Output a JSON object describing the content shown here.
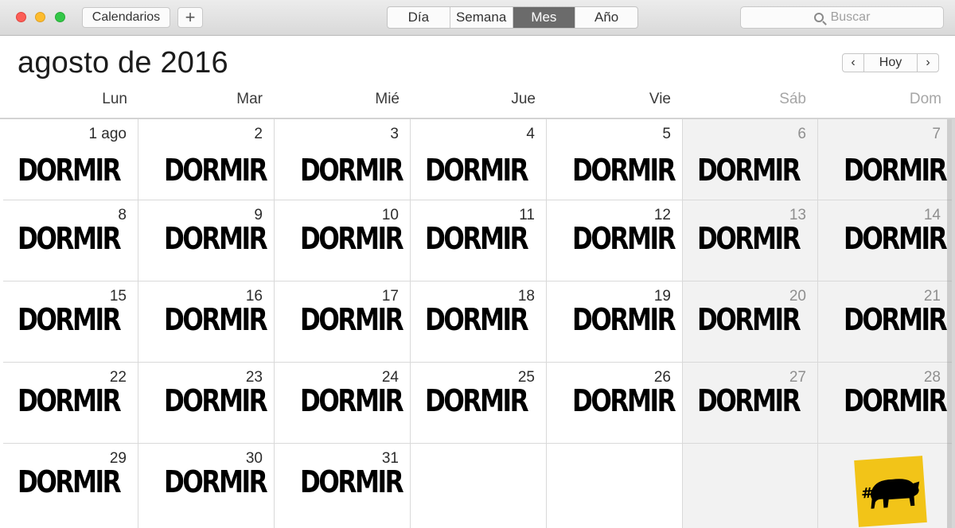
{
  "toolbar": {
    "calendars_label": "Calendarios",
    "add_label": "+",
    "view_modes": [
      "Día",
      "Semana",
      "Mes",
      "Año"
    ],
    "active_mode": "Mes",
    "search_placeholder": "Buscar"
  },
  "header": {
    "month_title": "agosto de 2016",
    "prev_label": "‹",
    "today_label": "Hoy",
    "next_label": "›"
  },
  "weekdays": [
    "Lun",
    "Mar",
    "Mié",
    "Jue",
    "Vie",
    "Sáb",
    "Dom"
  ],
  "weeks": [
    [
      "1 ago",
      "2",
      "3",
      "4",
      "5",
      "6",
      "7"
    ],
    [
      "8",
      "9",
      "10",
      "11",
      "12",
      "13",
      "14"
    ],
    [
      "15",
      "16",
      "17",
      "18",
      "19",
      "20",
      "21"
    ],
    [
      "22",
      "23",
      "24",
      "25",
      "26",
      "27",
      "28"
    ],
    [
      "29",
      "30",
      "31",
      "",
      "",
      "",
      ""
    ]
  ],
  "event_label": "DORMIR",
  "colors": {
    "weekend_bg": "#f2f2f2",
    "active_segment": "#6b6b6b",
    "logo_bg": "#f2c418"
  },
  "logo_text": "#"
}
